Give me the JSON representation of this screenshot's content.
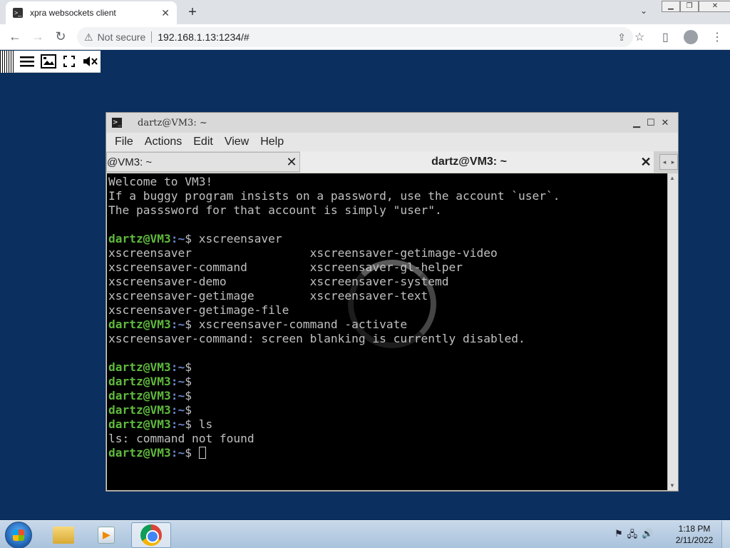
{
  "browser": {
    "tab_title": "xpra websockets client",
    "tab_close": "✕",
    "new_tab": "+",
    "security_label": "Not secure",
    "url": "192.168.1.13:1234/#",
    "back": "←",
    "forward": "→",
    "reload": "↻"
  },
  "terminal": {
    "window_title": "dartz@VM3: ~",
    "menu": [
      "File",
      "Actions",
      "Edit",
      "View",
      "Help"
    ],
    "tabs": [
      {
        "label": "@VM3: ~",
        "active": false
      },
      {
        "label": "dartz@VM3: ~",
        "active": true
      }
    ],
    "prompt_user": "dartz@VM3",
    "prompt_path": ":~",
    "lines": [
      {
        "type": "text",
        "text": "Welcome to VM3!"
      },
      {
        "type": "text",
        "text": "If a buggy program insists on a password, use the account `user`."
      },
      {
        "type": "text",
        "text": "The passsword for that account is simply \"user\"."
      },
      {
        "type": "text",
        "text": ""
      },
      {
        "type": "prompt",
        "cmd": "$ xscreensaver"
      },
      {
        "type": "text",
        "text": "xscreensaver                 xscreensaver-getimage-video"
      },
      {
        "type": "text",
        "text": "xscreensaver-command         xscreensaver-gl-helper"
      },
      {
        "type": "text",
        "text": "xscreensaver-demo            xscreensaver-systemd"
      },
      {
        "type": "text",
        "text": "xscreensaver-getimage        xscreensaver-text"
      },
      {
        "type": "text",
        "text": "xscreensaver-getimage-file"
      },
      {
        "type": "prompt",
        "cmd": "$ xscreensaver-command -activate"
      },
      {
        "type": "text",
        "text": "xscreensaver-command: screen blanking is currently disabled."
      },
      {
        "type": "text",
        "text": ""
      },
      {
        "type": "prompt",
        "cmd": "$"
      },
      {
        "type": "prompt",
        "cmd": "$"
      },
      {
        "type": "prompt",
        "cmd": "$"
      },
      {
        "type": "prompt",
        "cmd": "$"
      },
      {
        "type": "prompt",
        "cmd": "$ ls"
      },
      {
        "type": "text",
        "text": "ls: command not found"
      },
      {
        "type": "prompt",
        "cmd": "$ ",
        "cursor": true
      }
    ]
  },
  "taskbar": {
    "time": "1:18 PM",
    "date": "2/11/2022"
  },
  "colors": {
    "desktop": "#0b2f5e",
    "prompt_user": "#5fba3d",
    "prompt_path": "#6c87c9"
  }
}
